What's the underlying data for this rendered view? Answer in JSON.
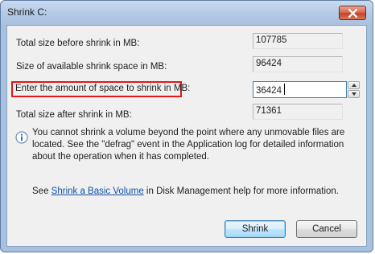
{
  "window": {
    "title": "Shrink C:"
  },
  "fields": {
    "total_before": {
      "label": "Total size before shrink in MB:",
      "value": "107785"
    },
    "available": {
      "label": "Size of available shrink space in MB:",
      "value": "96424"
    },
    "amount": {
      "label": "Enter the amount of space to shrink in MB:",
      "value": "36424"
    },
    "total_after": {
      "label": "Total size after shrink in MB:",
      "value": "71361"
    }
  },
  "info": {
    "icon": "info-icon",
    "text": "You cannot shrink a volume beyond the point where any unmovable files are located. See the \"defrag\" event in the Application log for detailed information about the operation when it has completed."
  },
  "help": {
    "prefix": "See ",
    "link": "Shrink a Basic Volume",
    "suffix": " in Disk Management help for more information."
  },
  "buttons": {
    "shrink": "Shrink",
    "cancel": "Cancel"
  },
  "colors": {
    "highlight": "#e01818",
    "link": "#0b52a8",
    "close_button": "#c24429"
  }
}
